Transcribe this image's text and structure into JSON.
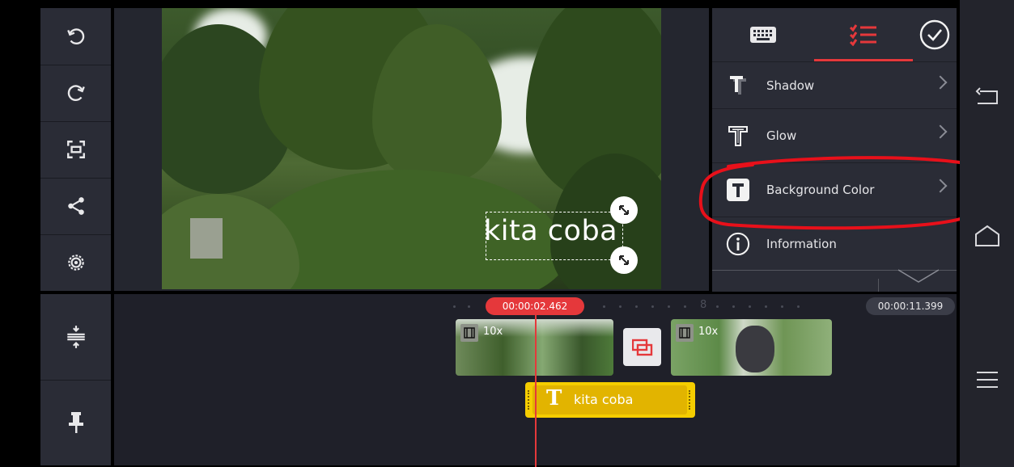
{
  "preview": {
    "overlay_text": "kita coba"
  },
  "panel": {
    "tabs": [
      {
        "icon": "keyboard-icon"
      },
      {
        "icon": "menu-list-icon",
        "active": true
      },
      {
        "icon": "check-circle-icon"
      }
    ],
    "items": [
      {
        "label": "Shadow",
        "icon": "text-shadow-icon"
      },
      {
        "label": "Glow",
        "icon": "text-glow-icon"
      },
      {
        "label": "Background Color",
        "icon": "text-background-icon"
      },
      {
        "label": "Information",
        "icon": "info-icon"
      }
    ]
  },
  "timeline": {
    "playhead_time": "00:00:02.462",
    "total_time": "00:00:11.399",
    "ruler_mark": "8",
    "clips": [
      {
        "speed": "10x"
      },
      {
        "speed": "10x"
      }
    ],
    "text_layer": {
      "label": "kita coba"
    }
  },
  "colors": {
    "accent": "#e5383b",
    "text_layer": "#e8b800",
    "panel_bg": "#2a2c36"
  }
}
